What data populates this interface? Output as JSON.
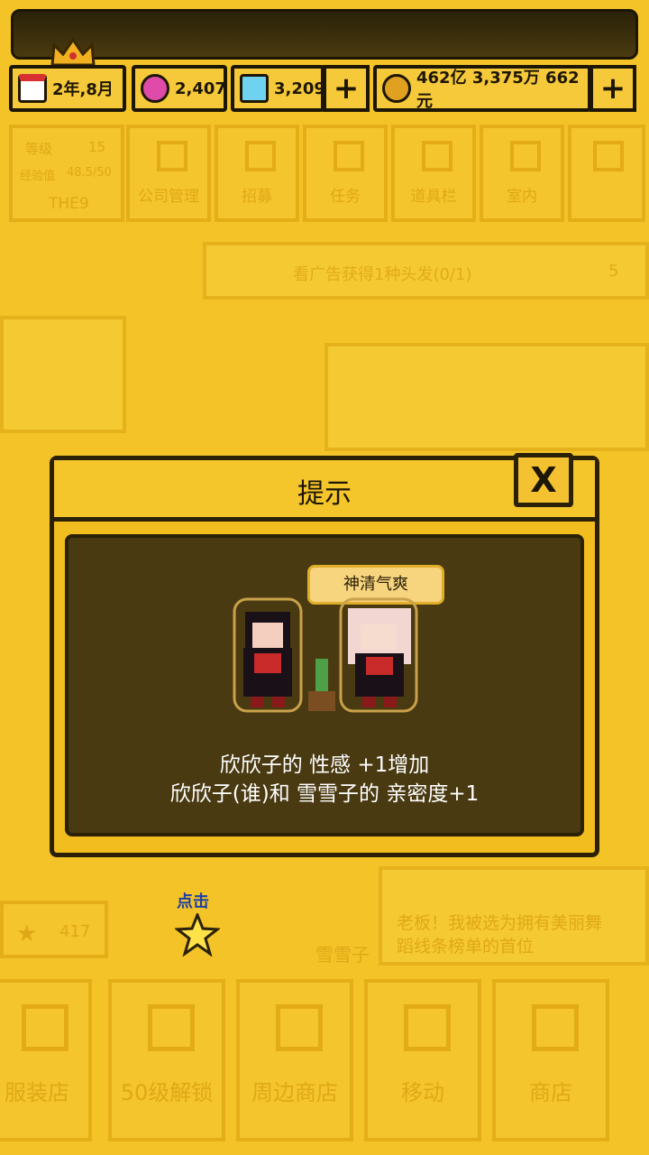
{
  "top": {
    "date": "2年,8月",
    "gems": "2,407",
    "diamonds": "3,209",
    "money": "462亿 3,375万 662元"
  },
  "background": {
    "level_label": "等级",
    "level_value": "15",
    "exp_label": "经验值",
    "exp_value": "48.5/50",
    "company_name": "THE9",
    "menu": [
      "公司管理",
      "招募",
      "任务",
      "道具栏",
      "室内"
    ],
    "ad_text": "看广告获得1种头发(0/1)",
    "ad_count": "5",
    "star_count": "417",
    "npc_name": "雪雪子",
    "npc_speech": "老板！我被选为拥有美丽舞蹈线条榜单的首位",
    "bottom_nav": [
      "服装店",
      "50级解锁",
      "周边商店",
      "移动",
      "商店"
    ]
  },
  "dialog": {
    "title": "提示",
    "close": "X",
    "mood": "神清气爽",
    "line1": "欣欣子的 性感 +1增加",
    "line2": "欣欣子(谁)和 雪雪子的 亲密度+1"
  },
  "hint": {
    "click_label": "点击"
  },
  "colors": {
    "background": "#f2c125",
    "dialog_body": "#4a3a12",
    "outline": "#2b2107",
    "hint_text": "#1e3fa6"
  }
}
